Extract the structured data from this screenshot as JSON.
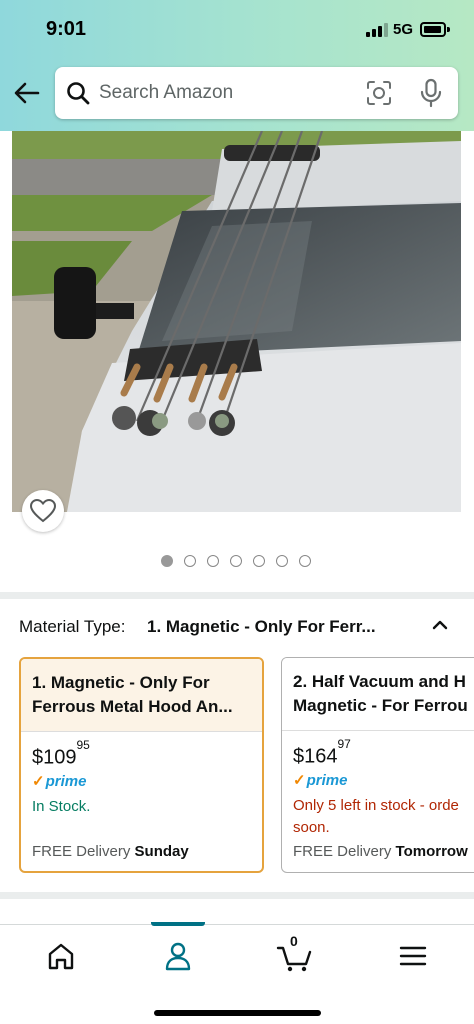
{
  "status_bar": {
    "time": "9:01",
    "network": "5G"
  },
  "search": {
    "placeholder": "Search Amazon",
    "left_icon": "search-icon",
    "right_icons": [
      "camera-lens-icon",
      "microphone-icon"
    ]
  },
  "gallery": {
    "image_count": 7,
    "active_index": 0,
    "wishlist_icon": "heart-icon"
  },
  "variation": {
    "label": "Material Type:",
    "selected_value": "1. Magnetic - Only For Ferr...",
    "options": [
      {
        "title_line1": "1. Magnetic - Only For",
        "title_line2": "Ferrous Metal Hood An...",
        "price_whole": "$109",
        "price_fraction": "95",
        "prime": "prime",
        "stock": "In Stock.",
        "stock_line2": "",
        "delivery_prefix": "FREE Delivery",
        "delivery_day": "Sunday"
      },
      {
        "title_line1": "2. Half Vacuum and H",
        "title_line2": "Magnetic - For Ferrou",
        "price_whole": "$164",
        "price_fraction": "97",
        "prime": "prime",
        "stock": "Only 5 left in stock - orde",
        "stock_line2": "soon.",
        "delivery_prefix": "FREE Delivery",
        "delivery_day": "Tomorrow"
      }
    ]
  },
  "bottom_nav": {
    "items": [
      "home-icon",
      "account-icon",
      "cart-icon",
      "menu-icon"
    ],
    "active_item": "account-icon",
    "cart_count": "0"
  },
  "colors": {
    "header_start": "#8fd8dc",
    "header_end": "#b6e8c4",
    "selected_border": "#e5a33e",
    "prime_blue": "#1a98d5",
    "in_stock_green": "#067d62",
    "low_stock_red": "#b12704",
    "nav_accent": "#007185"
  }
}
